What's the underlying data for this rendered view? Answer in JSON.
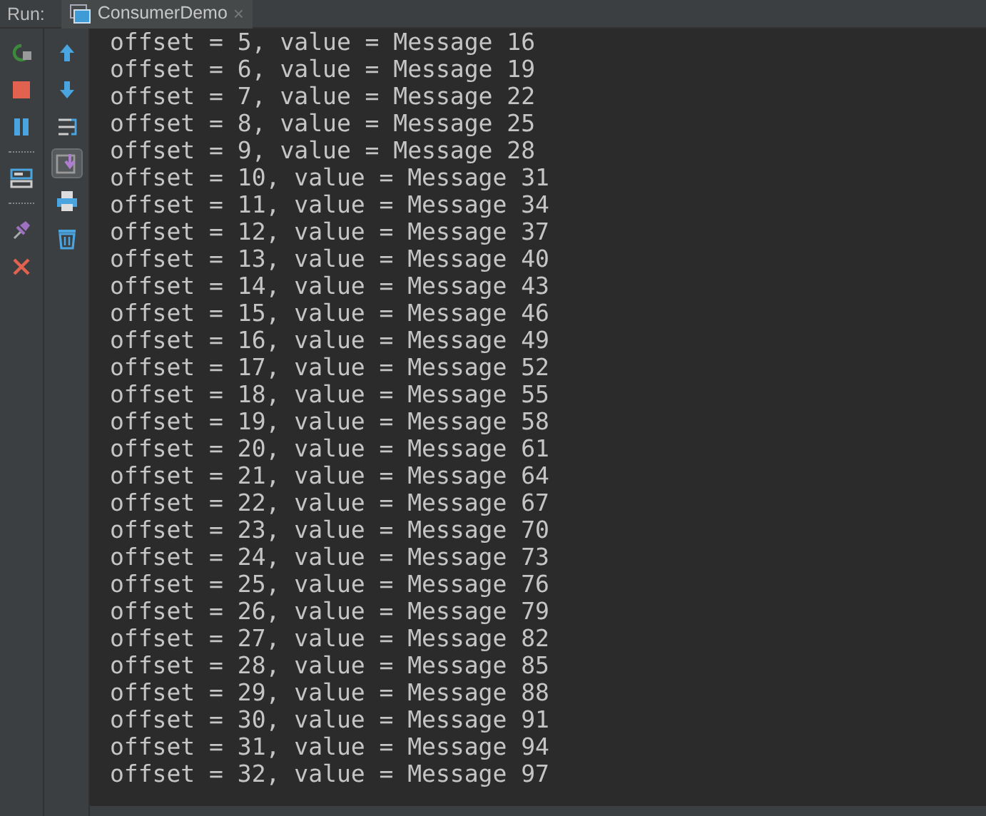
{
  "header": {
    "label": "Run:",
    "tab": {
      "title": "ConsumerDemo",
      "close": "×",
      "selected": true
    }
  },
  "left_toolbar": [
    {
      "kind": "rerun"
    },
    {
      "kind": "stop"
    },
    {
      "kind": "pause"
    },
    {
      "kind": "separator"
    },
    {
      "kind": "layout"
    },
    {
      "kind": "separator"
    },
    {
      "kind": "pin"
    },
    {
      "kind": "close"
    }
  ],
  "right_toolbar": [
    {
      "kind": "up",
      "on": false
    },
    {
      "kind": "down",
      "on": false
    },
    {
      "kind": "wrap",
      "on": false
    },
    {
      "kind": "scroll-end",
      "on": true
    },
    {
      "kind": "print",
      "on": false
    },
    {
      "kind": "trash",
      "on": false
    }
  ],
  "console_lines": [
    "offset = 5, value = Message 16",
    "offset = 6, value = Message 19",
    "offset = 7, value = Message 22",
    "offset = 8, value = Message 25",
    "offset = 9, value = Message 28",
    "offset = 10, value = Message 31",
    "offset = 11, value = Message 34",
    "offset = 12, value = Message 37",
    "offset = 13, value = Message 40",
    "offset = 14, value = Message 43",
    "offset = 15, value = Message 46",
    "offset = 16, value = Message 49",
    "offset = 17, value = Message 52",
    "offset = 18, value = Message 55",
    "offset = 19, value = Message 58",
    "offset = 20, value = Message 61",
    "offset = 21, value = Message 64",
    "offset = 22, value = Message 67",
    "offset = 23, value = Message 70",
    "offset = 24, value = Message 73",
    "offset = 25, value = Message 76",
    "offset = 26, value = Message 79",
    "offset = 27, value = Message 82",
    "offset = 28, value = Message 85",
    "offset = 29, value = Message 88",
    "offset = 30, value = Message 91",
    "offset = 31, value = Message 94",
    "offset = 32, value = Message 97"
  ]
}
